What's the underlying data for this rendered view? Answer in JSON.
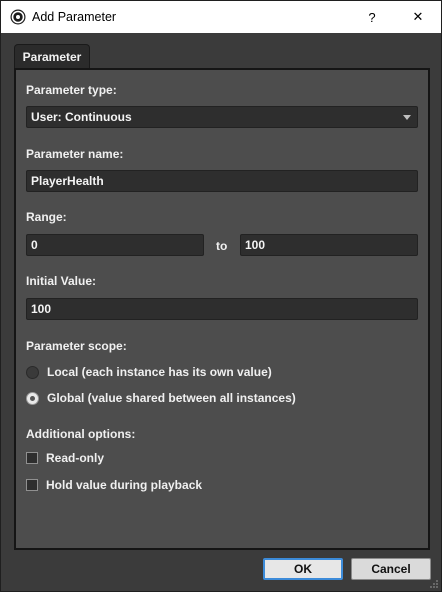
{
  "window": {
    "title": "Add Parameter",
    "help_label": "?",
    "close_label": "✕"
  },
  "tab": {
    "label": "Parameter"
  },
  "form": {
    "parameter_type": {
      "label": "Parameter type:",
      "value": "User: Continuous"
    },
    "parameter_name": {
      "label": "Parameter name:",
      "value": "PlayerHealth"
    },
    "range": {
      "label": "Range:",
      "min": "0",
      "to_label": "to",
      "max": "100"
    },
    "initial_value": {
      "label": "Initial Value:",
      "value": "100"
    },
    "scope": {
      "label": "Parameter scope:",
      "options": [
        {
          "label": "Local (each instance has its own value)",
          "checked": false
        },
        {
          "label": "Global (value shared between all instances)",
          "checked": true
        }
      ]
    },
    "additional": {
      "label": "Additional options:",
      "options": [
        {
          "label": "Read-only",
          "checked": false
        },
        {
          "label": "Hold value during playback",
          "checked": false
        }
      ]
    }
  },
  "buttons": {
    "ok": "OK",
    "cancel": "Cancel"
  },
  "colors": {
    "panel_bg": "#4d4d4d",
    "field_bg": "#2e2e2e",
    "accent": "#3c8bd9"
  }
}
